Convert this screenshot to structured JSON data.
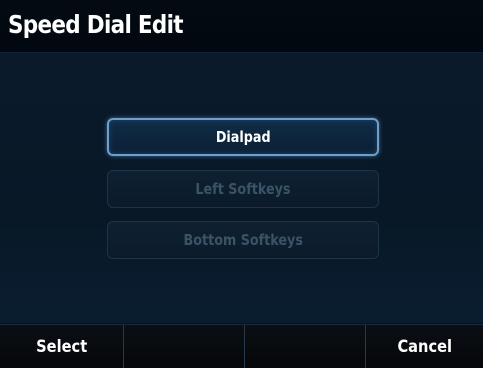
{
  "header": {
    "title": "Speed Dial Edit"
  },
  "menu": {
    "items": [
      {
        "label": "Dialpad",
        "state": "selected"
      },
      {
        "label": "Left Softkeys",
        "state": "disabled"
      },
      {
        "label": "Bottom Softkeys",
        "state": "disabled"
      }
    ]
  },
  "softkeys": {
    "keys": [
      {
        "label": "Select"
      },
      {
        "label": ""
      },
      {
        "label": ""
      },
      {
        "label": "Cancel"
      }
    ]
  },
  "colors": {
    "background": "#06121f",
    "selected_border": "#6f9fc8",
    "disabled_text": "#3b5367",
    "text": "#ffffff"
  }
}
